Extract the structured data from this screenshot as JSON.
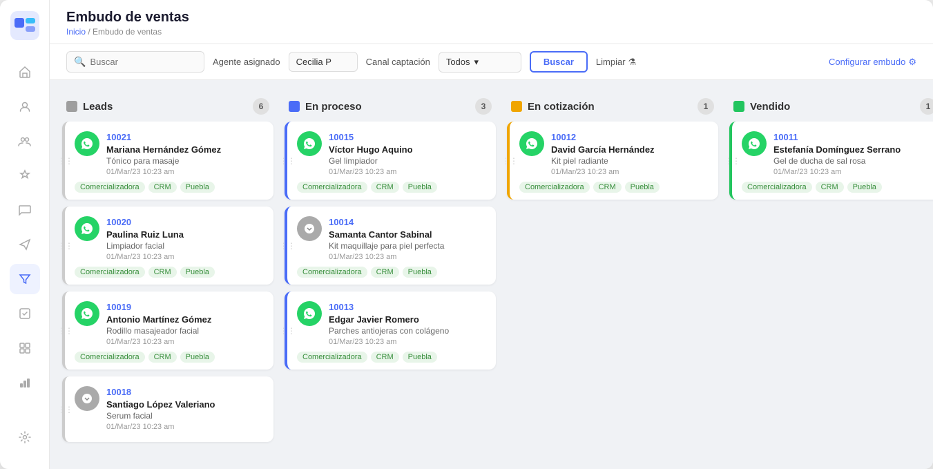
{
  "app": {
    "title": "Embudo de ventas",
    "breadcrumb_home": "Inicio",
    "breadcrumb_current": "Embudo de ventas"
  },
  "toolbar": {
    "search_placeholder": "Buscar",
    "agent_label": "Agente asignado",
    "agent_value": "Cecilia P",
    "canal_label": "Canal captación",
    "canal_value": "Todos",
    "buscar_label": "Buscar",
    "limpiar_label": "Limpiar",
    "configurar_label": "Configurar embudo"
  },
  "columns": [
    {
      "id": "leads",
      "title": "Leads",
      "color": "#9e9e9e",
      "count": "6",
      "cards": [
        {
          "id": "10021",
          "name": "Mariana Hernández Gómez",
          "product": "Tónico para masaje",
          "date": "01/Mar/23 10:23 am",
          "avatar_type": "whatsapp",
          "tags": [
            "Comercializadora",
            "CRM",
            "Puebla"
          ]
        },
        {
          "id": "10020",
          "name": "Paulina Ruiz Luna",
          "product": "Limpiador facial",
          "date": "01/Mar/23 10:23 am",
          "avatar_type": "whatsapp",
          "tags": [
            "Comercializadora",
            "CRM",
            "Puebla"
          ]
        },
        {
          "id": "10019",
          "name": "Antonio Martínez Gómez",
          "product": "Rodillo masajeador facial",
          "date": "01/Mar/23 10:23 am",
          "avatar_type": "whatsapp",
          "tags": [
            "Comercializadora",
            "CRM",
            "Puebla"
          ]
        },
        {
          "id": "10018",
          "name": "Santiago López Valeriano",
          "product": "Serum facial",
          "date": "01/Mar/23 10:23 am",
          "avatar_type": "messenger",
          "tags": []
        }
      ]
    },
    {
      "id": "enproceso",
      "title": "En proceso",
      "color": "#4a6cf7",
      "count": "3",
      "cards": [
        {
          "id": "10015",
          "name": "Víctor Hugo Aquino",
          "product": "Gel limpiador",
          "date": "01/Mar/23 10:23 am",
          "avatar_type": "whatsapp",
          "tags": [
            "Comercializadora",
            "CRM",
            "Puebla"
          ]
        },
        {
          "id": "10014",
          "name": "Samanta Cantor Sabinal",
          "product": "Kit maquillaje para piel perfecta",
          "date": "01/Mar/23 10:23 am",
          "avatar_type": "messenger",
          "tags": [
            "Comercializadora",
            "CRM",
            "Puebla"
          ]
        },
        {
          "id": "10013",
          "name": "Edgar Javier Romero",
          "product": "Parches antiojeras con colágeno",
          "date": "01/Mar/23 10:23 am",
          "avatar_type": "whatsapp",
          "tags": [
            "Comercializadora",
            "CRM",
            "Puebla"
          ]
        }
      ]
    },
    {
      "id": "encotizacion",
      "title": "En cotización",
      "color": "#f0a500",
      "count": "1",
      "cards": [
        {
          "id": "10012",
          "name": "David García Hernández",
          "product": "Kit piel radiante",
          "date": "01/Mar/23 10:23 am",
          "avatar_type": "whatsapp",
          "tags": [
            "Comercializadora",
            "CRM",
            "Puebla"
          ]
        }
      ]
    },
    {
      "id": "vendido",
      "title": "Vendido",
      "color": "#22c55e",
      "count": "1",
      "cards": [
        {
          "id": "10011",
          "name": "Estefanía Domínguez Serrano",
          "product": "Gel de ducha de sal rosa",
          "date": "01/Mar/23 10:23 am",
          "avatar_type": "whatsapp",
          "tags": [
            "Comercializadora",
            "CRM",
            "Puebla"
          ]
        }
      ]
    }
  ],
  "sidebar": {
    "nav_items": [
      {
        "icon": "⌂",
        "name": "home-icon",
        "label": "Inicio"
      },
      {
        "icon": "👤",
        "name": "contacts-icon",
        "label": "Contactos"
      },
      {
        "icon": "👥",
        "name": "groups-icon",
        "label": "Grupos"
      },
      {
        "icon": "★",
        "name": "favorites-icon",
        "label": "Favoritos"
      },
      {
        "icon": "💬",
        "name": "messages-icon",
        "label": "Mensajes"
      },
      {
        "icon": "✈",
        "name": "campaigns-icon",
        "label": "Campañas"
      },
      {
        "icon": "▼",
        "name": "funnel-icon",
        "label": "Embudo",
        "active": true
      },
      {
        "icon": "✓",
        "name": "tasks-icon",
        "label": "Tareas"
      },
      {
        "icon": "▦",
        "name": "board-icon",
        "label": "Tablero"
      },
      {
        "icon": "📊",
        "name": "reports-icon",
        "label": "Reportes"
      }
    ]
  }
}
